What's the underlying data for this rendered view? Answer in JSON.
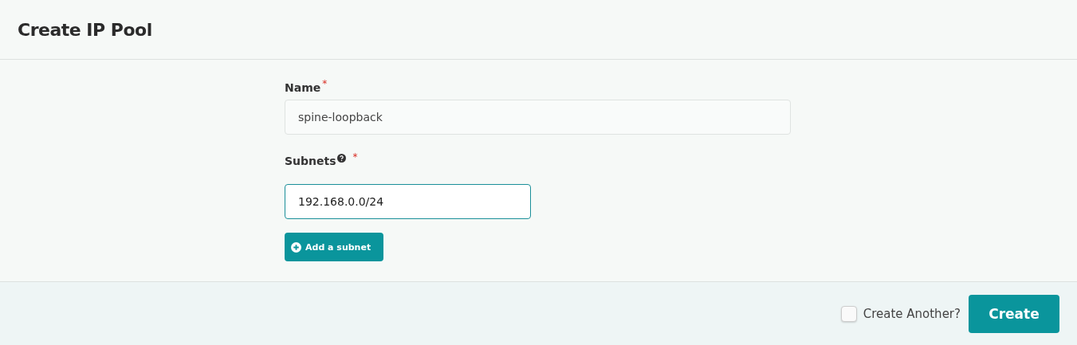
{
  "dialog": {
    "title": "Create IP Pool"
  },
  "fields": [
    {
      "kind": "text",
      "label": "Name",
      "required_mark": "*",
      "help": false,
      "value": "spine-loopback",
      "focused": false
    },
    {
      "kind": "subnet",
      "label": "Subnets",
      "required_mark": "*",
      "help": true,
      "value": "192.168.0.0/24",
      "focused": true
    }
  ],
  "add_button": {
    "label": "Add a subnet"
  },
  "footer": {
    "create_another": {
      "label": "Create Another?",
      "checked": false
    },
    "submit": {
      "label": "Create"
    }
  }
}
